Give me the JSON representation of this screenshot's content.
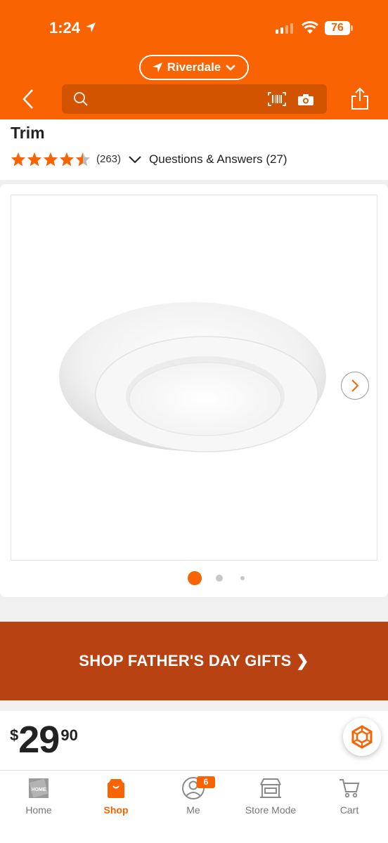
{
  "status_bar": {
    "time": "1:24",
    "battery": "76"
  },
  "header": {
    "location": "Riverdale",
    "search": {
      "placeholder": "",
      "value": ""
    }
  },
  "product": {
    "title_visible": "Trim",
    "rating": 4.5,
    "review_count": "(263)",
    "qa_label": "Questions & Answers (27)"
  },
  "gallery": {
    "image_count": 3,
    "active_index": 0
  },
  "promo": {
    "label": "SHOP FATHER'S DAY GIFTS ❯"
  },
  "price": {
    "currency": "$",
    "dollars": "29",
    "cents": "90"
  },
  "tabs": [
    {
      "label": "Home",
      "icon": "home-depot-logo-icon"
    },
    {
      "label": "Shop",
      "icon": "shop-bag-icon",
      "active": true
    },
    {
      "label": "Me",
      "icon": "profile-icon",
      "badge": "6"
    },
    {
      "label": "Store Mode",
      "icon": "store-icon"
    },
    {
      "label": "Cart",
      "icon": "cart-icon"
    }
  ],
  "colors": {
    "brand": "#f96302",
    "banner": "#b94212",
    "search_bg": "#d35400"
  }
}
